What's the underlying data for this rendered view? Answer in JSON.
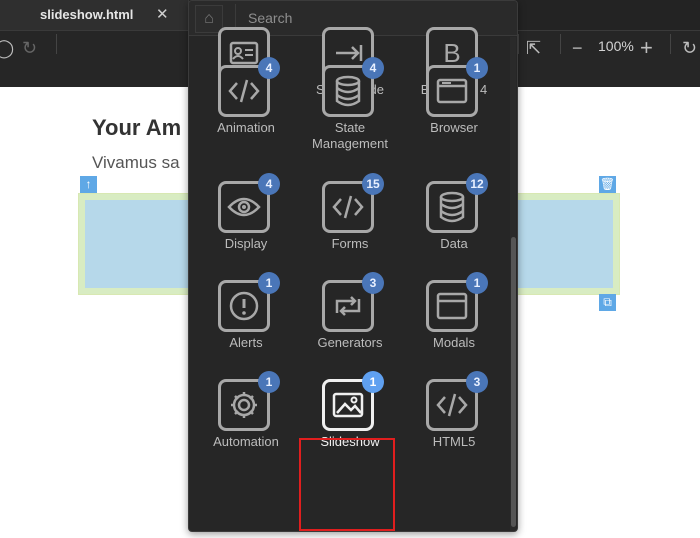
{
  "browser": {
    "tab_title": "slideshow.html",
    "tab_close": "✕",
    "zoom": "100%"
  },
  "page": {
    "heading": "Your Am",
    "paragraph": "Vivamus sa"
  },
  "panel": {
    "search_placeholder": "Search",
    "items": [
      {
        "label": "Cards",
        "icon": "card-icon",
        "badge": ""
      },
      {
        "label": "Server Side Includes",
        "icon": "include-icon",
        "badge": ""
      },
      {
        "label": "Bootstrap 4",
        "icon": "bootstrap-icon",
        "badge": ""
      },
      {
        "label": "Animation",
        "icon": "code-icon",
        "badge": "4"
      },
      {
        "label": "State Management",
        "icon": "database-icon",
        "badge": "4"
      },
      {
        "label": "Browser",
        "icon": "browser-icon",
        "badge": "1"
      },
      {
        "label": "Display",
        "icon": "eye-icon",
        "badge": "4"
      },
      {
        "label": "Forms",
        "icon": "code-icon",
        "badge": "15"
      },
      {
        "label": "Data",
        "icon": "database-icon",
        "badge": "12"
      },
      {
        "label": "Alerts",
        "icon": "alert-icon",
        "badge": "1"
      },
      {
        "label": "Generators",
        "icon": "repeat-icon",
        "badge": "3"
      },
      {
        "label": "Modals",
        "icon": "modal-icon",
        "badge": "1"
      },
      {
        "label": "Automation",
        "icon": "gear-icon",
        "badge": "1"
      },
      {
        "label": "Slideshow",
        "icon": "image-icon",
        "badge": "1"
      },
      {
        "label": "HTML5",
        "icon": "code-icon",
        "badge": "3"
      }
    ]
  }
}
